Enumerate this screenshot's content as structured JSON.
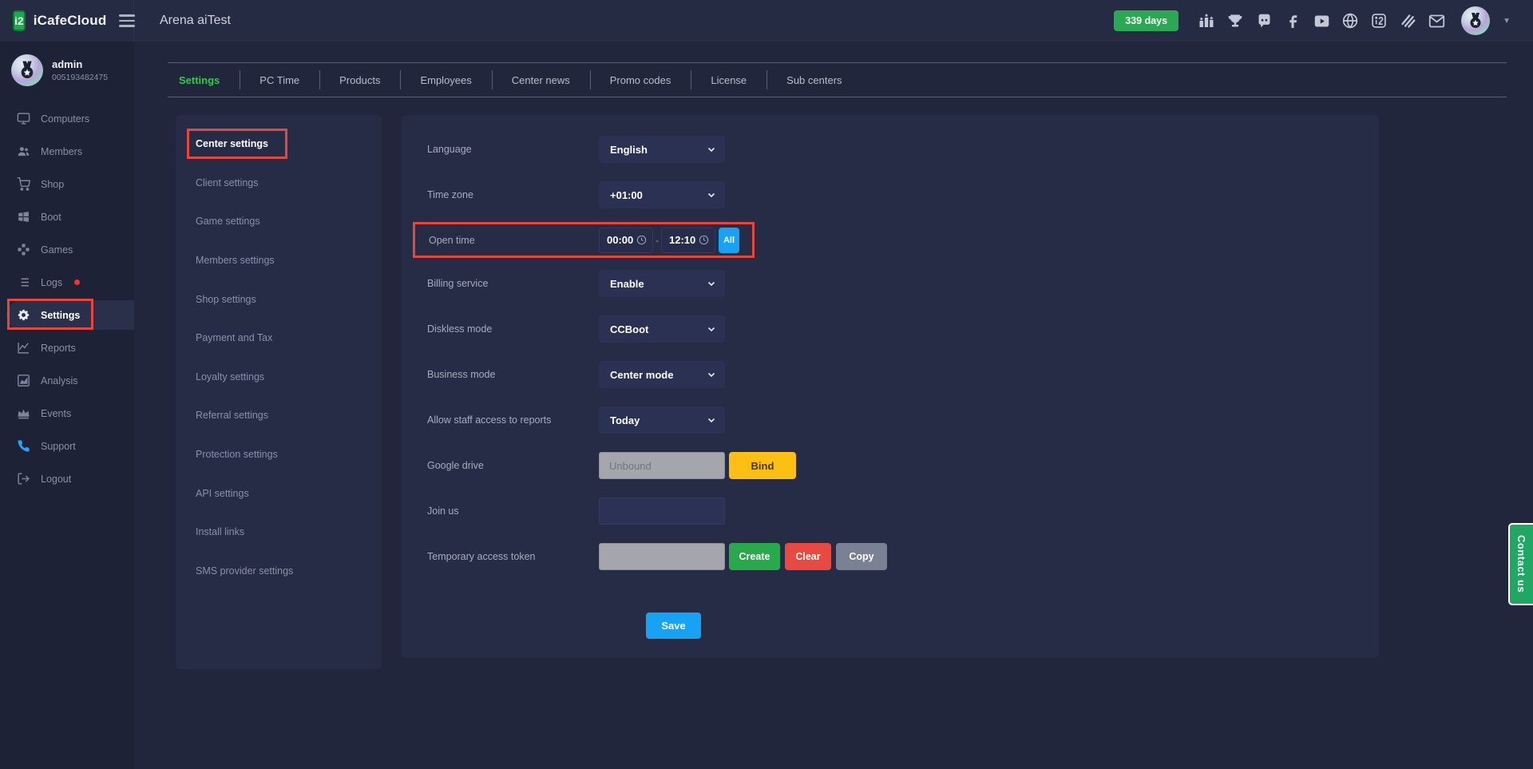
{
  "topbar": {
    "logo_text": "iCafeCloud",
    "logo_glyph": "i2",
    "page_title": "Arena aiTest",
    "days_badge": "339 days"
  },
  "user": {
    "name": "admin",
    "id": "005193482475"
  },
  "sidebar": {
    "items": [
      {
        "label": "Computers"
      },
      {
        "label": "Members"
      },
      {
        "label": "Shop"
      },
      {
        "label": "Boot"
      },
      {
        "label": "Games"
      },
      {
        "label": "Logs"
      },
      {
        "label": "Settings"
      },
      {
        "label": "Reports"
      },
      {
        "label": "Analysis"
      },
      {
        "label": "Events"
      },
      {
        "label": "Support"
      },
      {
        "label": "Logout"
      }
    ]
  },
  "tabs": {
    "items": [
      "Settings",
      "PC Time",
      "Products",
      "Employees",
      "Center news",
      "Promo codes",
      "License",
      "Sub centers"
    ]
  },
  "settings_menu": {
    "items": [
      "Center settings",
      "Client settings",
      "Game settings",
      "Members settings",
      "Shop settings",
      "Payment and Tax",
      "Loyalty settings",
      "Referral settings",
      "Protection settings",
      "API settings",
      "Install links",
      "SMS provider settings"
    ]
  },
  "form": {
    "language": {
      "label": "Language",
      "value": "English"
    },
    "timezone": {
      "label": "Time zone",
      "value": "+01:00"
    },
    "open_time": {
      "label": "Open time",
      "start": "00:00",
      "end": "12:10",
      "separator": "-",
      "all_button": "All"
    },
    "billing": {
      "label": "Billing service",
      "value": "Enable"
    },
    "diskless": {
      "label": "Diskless mode",
      "value": "CCBoot"
    },
    "business": {
      "label": "Business mode",
      "value": "Center mode"
    },
    "staff_reports": {
      "label": "Allow staff access to reports",
      "value": "Today"
    },
    "google_drive": {
      "label": "Google drive",
      "placeholder": "Unbound",
      "bind_button": "Bind"
    },
    "join_us": {
      "label": "Join us",
      "value": ""
    },
    "token": {
      "label": "Temporary access token",
      "value": "",
      "create_button": "Create",
      "clear_button": "Clear",
      "copy_button": "Copy"
    },
    "save_button": "Save"
  },
  "contact_tab": {
    "label": "Contact us"
  },
  "colors": {
    "accent_green": "#28a952",
    "tab_active_green": "#2ecb51",
    "accent_blue": "#17a2f3",
    "accent_yellow": "#fdc012",
    "danger_red": "#e84a42",
    "highlight_border_red": "#e8463d",
    "contact_green": "#1fa763"
  }
}
